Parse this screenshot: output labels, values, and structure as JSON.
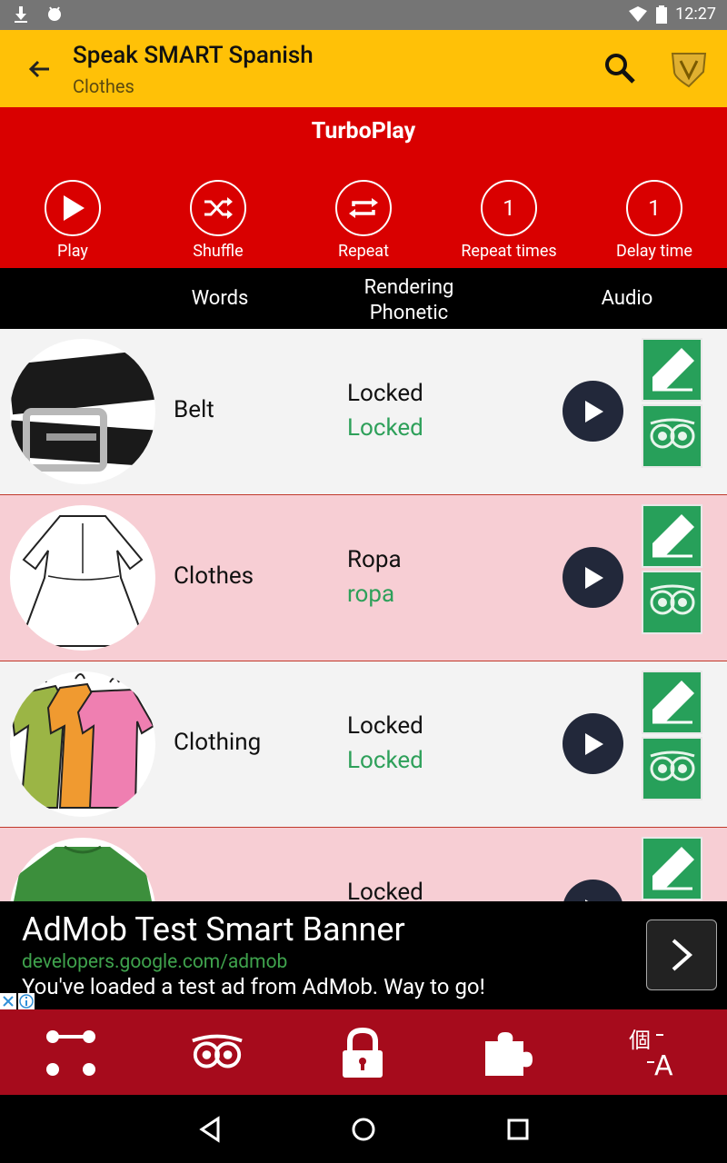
{
  "status": {
    "time": "12:27"
  },
  "toolbar": {
    "title": "Speak SMART Spanish",
    "subtitle": "Clothes"
  },
  "turbo": {
    "heading": "TurboPlay",
    "buttons": [
      {
        "label": "Play",
        "icon": "play-icon"
      },
      {
        "label": "Shuffle",
        "icon": "shuffle-icon"
      },
      {
        "label": "Repeat",
        "icon": "repeat-icon"
      },
      {
        "label": "Repeat times",
        "value": "1"
      },
      {
        "label": "Delay time",
        "value": "1"
      }
    ]
  },
  "columns": {
    "words": "Words",
    "rendering": "Rendering",
    "phonetic": "Phonetic",
    "audio": "Audio"
  },
  "rows": [
    {
      "word": "Belt",
      "rendering": "Locked",
      "phonetic": "Locked"
    },
    {
      "word": "Clothes",
      "rendering": "Ropa",
      "phonetic": "ropa"
    },
    {
      "word": "Clothing",
      "rendering": "Locked",
      "phonetic": "Locked"
    },
    {
      "word": "",
      "rendering": "Locked",
      "phonetic": ""
    }
  ],
  "ad": {
    "title": "AdMob Test Smart Banner",
    "url": "developers.google.com/admob",
    "description": "You've loaded a test ad from AdMob. Way to go!"
  },
  "colors": {
    "toolbar": "#ffc107",
    "turbo": "#d90000",
    "bottomnav": "#a60b1c",
    "accent_green": "#27a05a"
  }
}
